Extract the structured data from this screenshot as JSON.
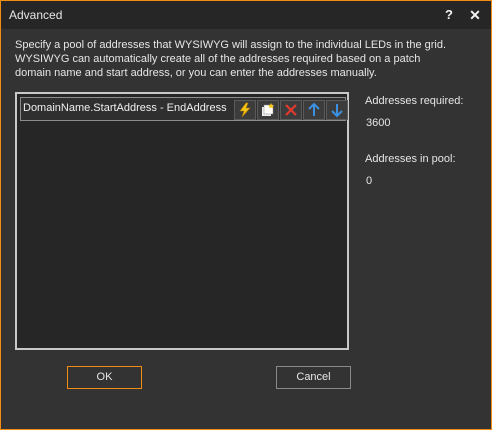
{
  "window": {
    "title": "Advanced",
    "help_label": "?",
    "close_label": "✕"
  },
  "description": "Specify a pool of addresses that WYSIWYG will assign to the individual LEDs in the grid. WYSIWYG can automatically create all of the addresses required based on a patch domain name and start address, or you can enter the addresses manually.",
  "pool": {
    "row_label": "DomainName.StartAddress - EndAddress",
    "toolbar_icons": [
      "lightning-icon",
      "auto-generate-icon",
      "delete-icon",
      "move-up-icon",
      "move-down-icon"
    ]
  },
  "info": {
    "required_label": "Addresses required:",
    "required_value": "3600",
    "pool_label": "Addresses in pool:",
    "pool_value": "0"
  },
  "buttons": {
    "ok": "OK",
    "cancel": "Cancel"
  },
  "colors": {
    "accent": "#f28c13",
    "background": "#333333",
    "titlebar": "#262626",
    "list_bg": "#262626"
  }
}
